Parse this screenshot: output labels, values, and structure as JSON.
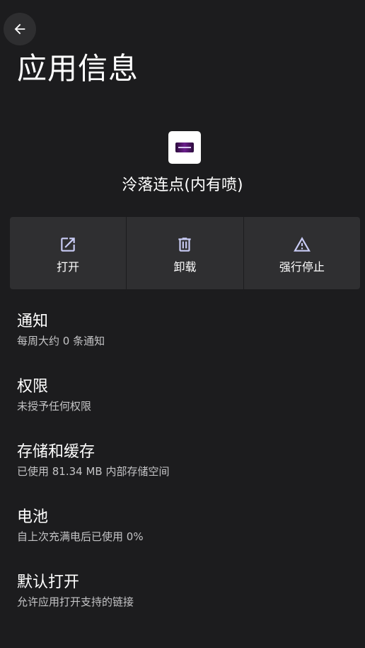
{
  "header": {
    "back_icon": "arrow-left-icon",
    "title": "应用信息"
  },
  "app": {
    "name": "泠落连点(内有喷)"
  },
  "actions": [
    {
      "label": "打开",
      "icon": "open-in-new-icon"
    },
    {
      "label": "卸载",
      "icon": "trash-icon"
    },
    {
      "label": "强行停止",
      "icon": "warning-icon"
    }
  ],
  "settings": [
    {
      "title": "通知",
      "summary": "每周大约 0 条通知"
    },
    {
      "title": "权限",
      "summary": "未授予任何权限"
    },
    {
      "title": "存储和缓存",
      "summary": "已使用 81.34 MB 内部存储空间"
    },
    {
      "title": "电池",
      "summary": "自上次充满电后已使用 0%"
    },
    {
      "title": "默认打开",
      "summary": "允许应用打开支持的链接"
    }
  ],
  "colors": {
    "background": "#1c1c1e",
    "surface": "#2f2f31",
    "text_primary": "#ffffff",
    "text_secondary": "#c4c4c6"
  }
}
